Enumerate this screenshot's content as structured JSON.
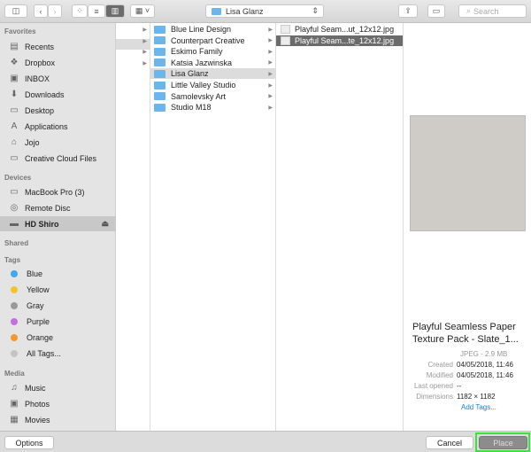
{
  "toolbar": {
    "path": "Lisa Glanz",
    "search_placeholder": "Search"
  },
  "sidebar": {
    "favorites_header": "Favorites",
    "favorites": [
      {
        "label": "Recents",
        "icon": "recents-icon",
        "g": "▤"
      },
      {
        "label": "Dropbox",
        "icon": "dropbox-icon",
        "g": "❖"
      },
      {
        "label": "INBOX",
        "icon": "inbox-icon",
        "g": "▣"
      },
      {
        "label": "Downloads",
        "icon": "downloads-icon",
        "g": "⬇"
      },
      {
        "label": "Desktop",
        "icon": "desktop-icon",
        "g": "▭"
      },
      {
        "label": "Applications",
        "icon": "applications-icon",
        "g": "A"
      },
      {
        "label": "Jojo",
        "icon": "home-icon",
        "g": "⌂"
      },
      {
        "label": "Creative Cloud Files",
        "icon": "folder-icon",
        "g": "▭"
      }
    ],
    "devices_header": "Devices",
    "devices": [
      {
        "label": "MacBook Pro (3)",
        "icon": "laptop-icon",
        "g": "▭"
      },
      {
        "label": "Remote Disc",
        "icon": "disc-icon",
        "g": "◎"
      },
      {
        "label": "HD Shiro",
        "icon": "harddrive-icon",
        "g": "▬"
      }
    ],
    "shared_header": "Shared",
    "tags_header": "Tags",
    "tags": [
      {
        "label": "Blue",
        "color": "#3ea8f0"
      },
      {
        "label": "Yellow",
        "color": "#f4c430"
      },
      {
        "label": "Gray",
        "color": "#9a9a9a"
      },
      {
        "label": "Purple",
        "color": "#c36fe0"
      },
      {
        "label": "Orange",
        "color": "#f6962b"
      },
      {
        "label": "All Tags...",
        "color": "#c4c4c4"
      }
    ],
    "media_header": "Media",
    "media": [
      {
        "label": "Music",
        "icon": "music-icon",
        "g": "♫"
      },
      {
        "label": "Photos",
        "icon": "photos-icon",
        "g": "▣"
      },
      {
        "label": "Movies",
        "icon": "movies-icon",
        "g": "▦"
      }
    ]
  },
  "folders": [
    "Blue Line Design",
    "Counterpart Creative",
    "Eskimo Family",
    "Katsia Jazwinska",
    "Lisa Glanz",
    "Little Valley Studio",
    "Samolevsky Art",
    "Studio M18"
  ],
  "files": [
    "Playful Seam...ut_12x12.jpg",
    "Playful Seam...te_12x12.jpg"
  ],
  "preview": {
    "title": "Playful Seamless Paper Texture Pack - Slate_1...",
    "kind": "JPEG - 2.9 MB",
    "meta": [
      {
        "k": "Created",
        "v": "04/05/2018, 11:46"
      },
      {
        "k": "Modified",
        "v": "04/05/2018, 11:46"
      },
      {
        "k": "Last opened",
        "v": "--"
      },
      {
        "k": "Dimensions",
        "v": "1182 × 1182"
      }
    ],
    "add_tags": "Add Tags..."
  },
  "buttons": {
    "options": "Options",
    "cancel": "Cancel",
    "place": "Place"
  }
}
